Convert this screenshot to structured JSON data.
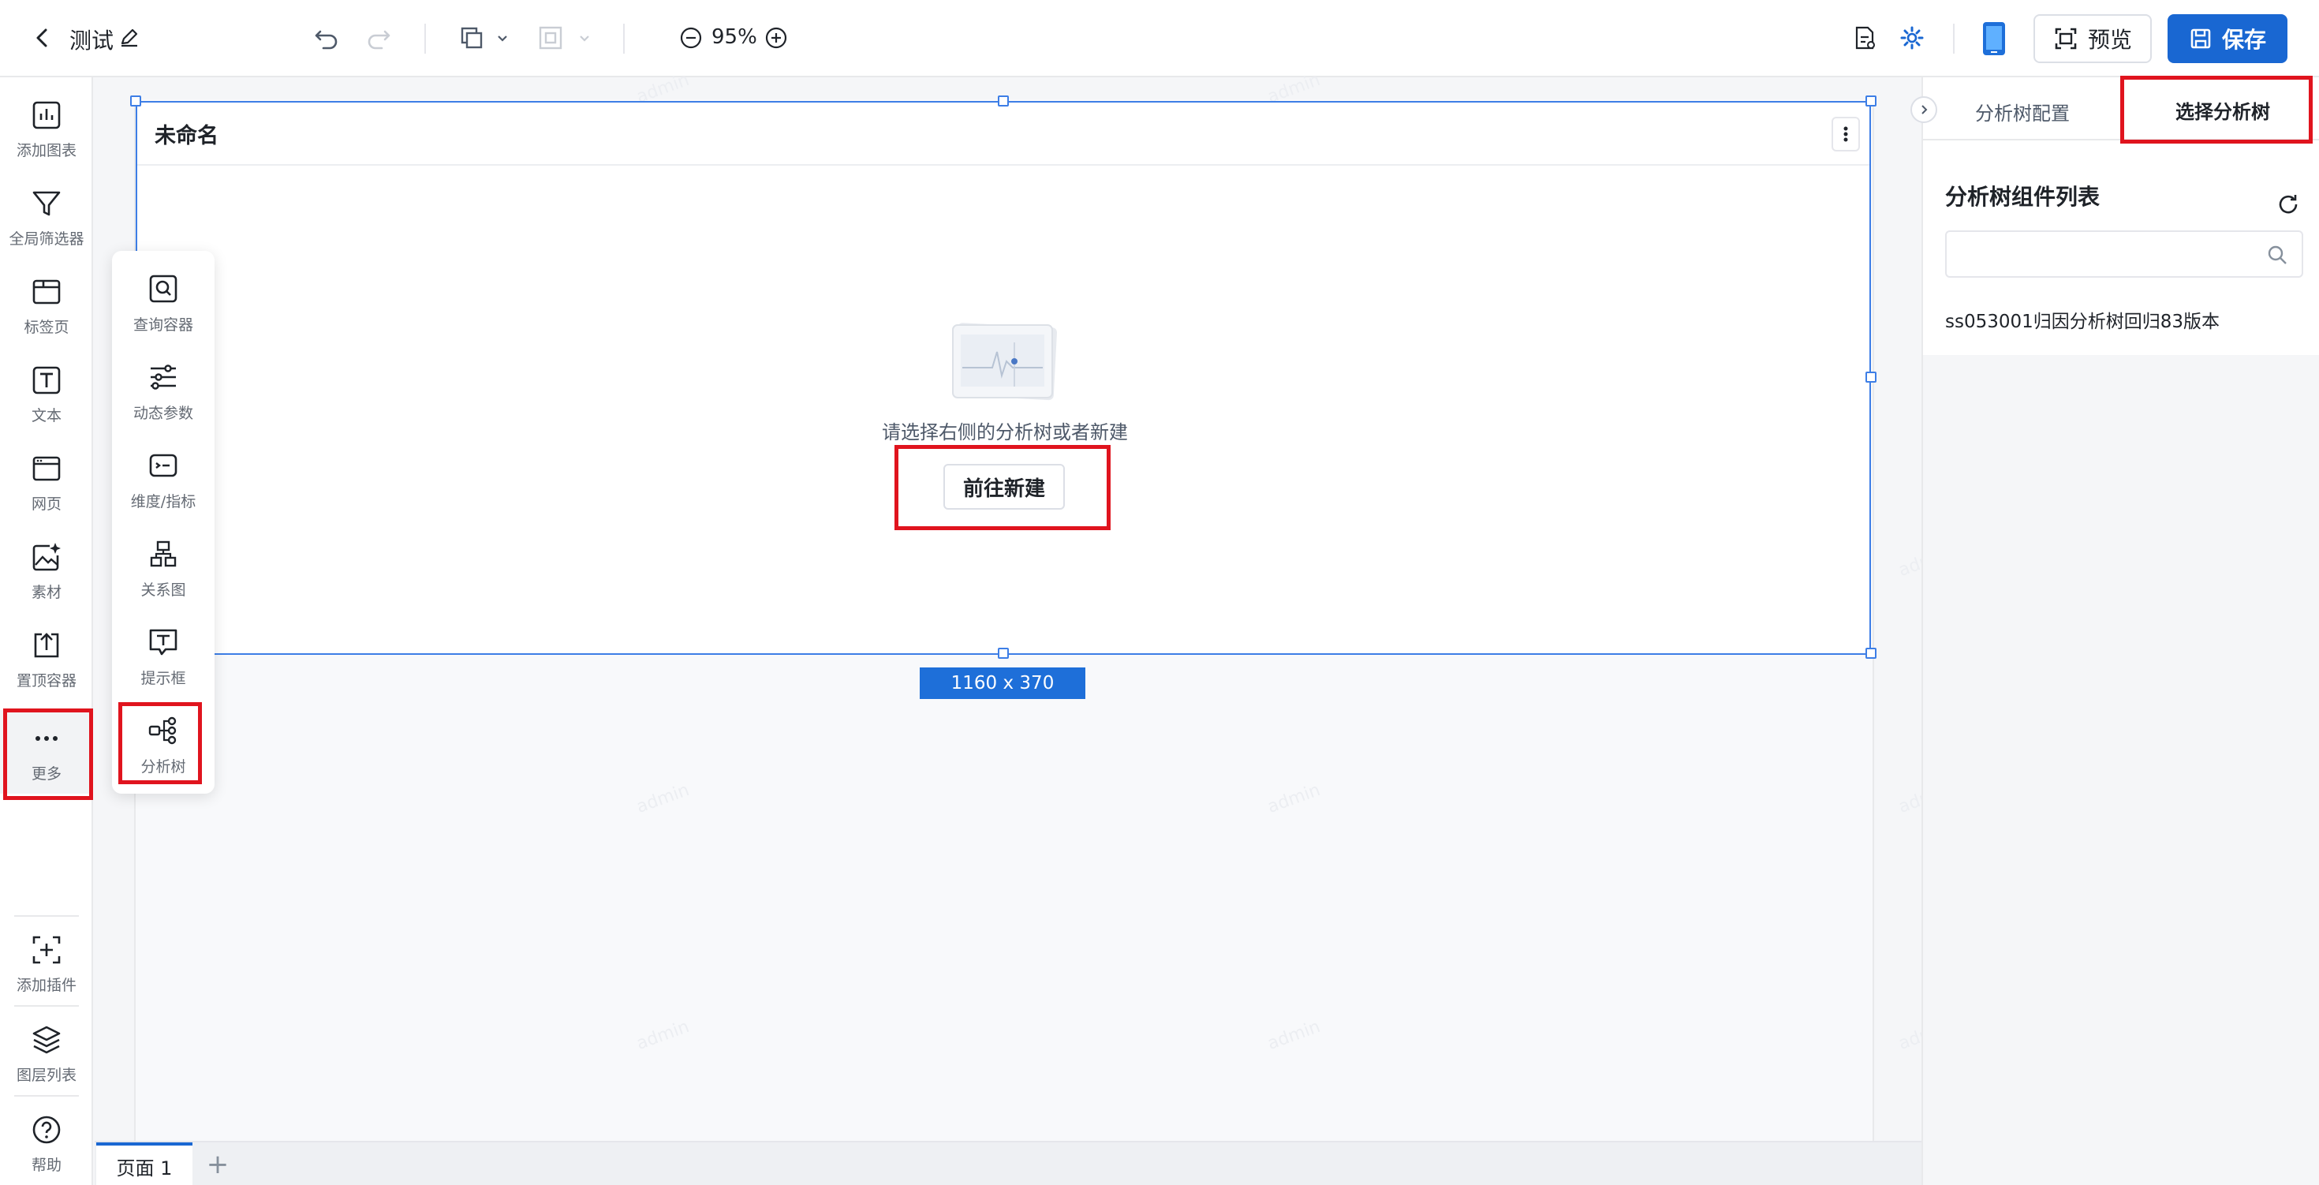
{
  "header": {
    "title": "测试",
    "zoom": "95%",
    "preview_label": "预览",
    "save_label": "保存"
  },
  "left_rail": {
    "items": [
      {
        "label": "添加图表"
      },
      {
        "label": "全局筛选器"
      },
      {
        "label": "标签页"
      },
      {
        "label": "文本"
      },
      {
        "label": "网页"
      },
      {
        "label": "素材"
      },
      {
        "label": "置顶容器"
      },
      {
        "label": "更多"
      }
    ],
    "bottom_items": [
      {
        "label": "添加插件"
      },
      {
        "label": "图层列表"
      },
      {
        "label": "帮助"
      }
    ]
  },
  "more_menu": {
    "items": [
      {
        "label": "查询容器"
      },
      {
        "label": "动态参数"
      },
      {
        "label": "维度/指标"
      },
      {
        "label": "关系图"
      },
      {
        "label": "提示框"
      },
      {
        "label": "分析树"
      }
    ]
  },
  "canvas": {
    "component_title": "未命名",
    "empty_text": "请选择右侧的分析树或者新建",
    "new_button_label": "前往新建",
    "size_label": "1160 x 370",
    "watermark": "admin"
  },
  "page_tabs": {
    "tabs": [
      {
        "label": "页面 1"
      }
    ],
    "add_label": "+"
  },
  "right_panel": {
    "tabs": [
      {
        "label": "分析树配置"
      },
      {
        "label": "选择分析树",
        "active": true
      }
    ],
    "heading": "分析树组件列表",
    "search_placeholder": "",
    "items": [
      {
        "label": "ss053001归因分析树回归83版本"
      }
    ]
  },
  "colors": {
    "primary": "#1967d2",
    "selection": "#3d7ee6",
    "annotation": "#e0141e"
  }
}
